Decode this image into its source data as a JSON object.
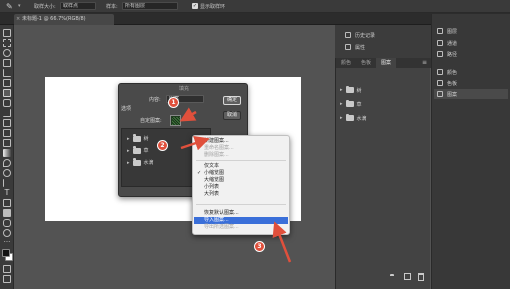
{
  "options_bar": {
    "sample_size_label": "取样大小:",
    "sample_size_value": "取样点",
    "sample_label": "样本:",
    "sample_value": "所有图层",
    "show_ring_label": "显示取样环"
  },
  "document_tab": {
    "title": "未标题-1 @ 66.7%(RGB/8)"
  },
  "right_dock_a": {
    "items": [
      {
        "label": "历史记录",
        "icon": "history-icon"
      },
      {
        "label": "属性",
        "icon": "properties-icon"
      }
    ]
  },
  "right_dock_b": {
    "items": [
      {
        "label": "图层",
        "icon": "layers-icon"
      },
      {
        "label": "通道",
        "icon": "channels-icon"
      },
      {
        "label": "路径",
        "icon": "paths-icon"
      },
      {
        "label": "颜色",
        "icon": "color-icon"
      },
      {
        "label": "色板",
        "icon": "swatches-icon"
      },
      {
        "label": "图案",
        "icon": "patterns-icon"
      }
    ],
    "active": "图案"
  },
  "patterns_panel": {
    "tabs": [
      "颜色",
      "色板",
      "图案"
    ],
    "active_tab": "图案",
    "groups": [
      "树",
      "草",
      "水滴"
    ]
  },
  "fill_dialog": {
    "title": "填充",
    "content_label": "内容:",
    "content_value": "图案",
    "options_label": "选项",
    "custom_pattern_label": "自定图案:",
    "ok_label": "确定",
    "cancel_label": "取消",
    "picker_groups": [
      "树",
      "草",
      "水滴"
    ]
  },
  "context_menu": {
    "items": [
      {
        "label": "新建图案...",
        "disabled": false
      },
      {
        "label": "重命名图案...",
        "disabled": true
      },
      {
        "label": "删除图案...",
        "disabled": true
      },
      {
        "label": "仅文本",
        "disabled": false
      },
      {
        "label": "小缩览图",
        "disabled": false,
        "checked": true
      },
      {
        "label": "大缩览图",
        "disabled": false
      },
      {
        "label": "小列表",
        "disabled": false
      },
      {
        "label": "大列表",
        "disabled": false
      },
      {
        "label": "恢复默认图案...",
        "disabled": false
      },
      {
        "label": "导入图案...",
        "disabled": false,
        "highlight": true
      },
      {
        "label": "导出所选图案...",
        "disabled": true
      }
    ]
  },
  "markers": [
    "1",
    "2",
    "3"
  ],
  "colors": {
    "marker": "#e0503c",
    "menu_highlight": "#3a6fd9",
    "workspace": "#535353"
  }
}
